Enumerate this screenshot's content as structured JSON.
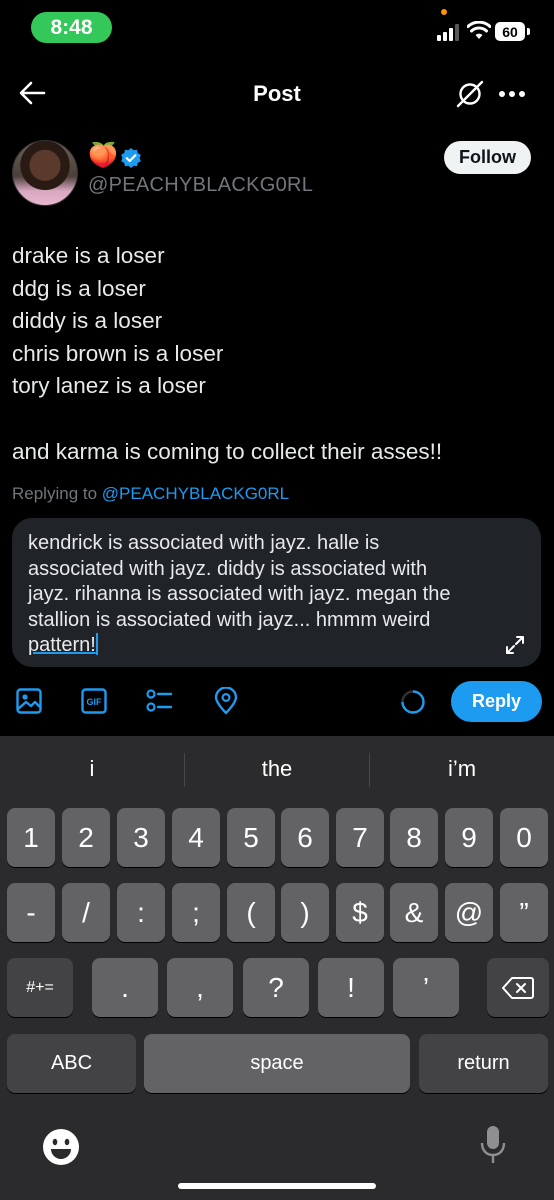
{
  "status_bar": {
    "time": "8:48",
    "battery": "60"
  },
  "header": {
    "title": "Post"
  },
  "post": {
    "author_emoji": "🍑",
    "handle": "@PEACHYBLACKG0RL",
    "follow_label": "Follow",
    "lines": [
      "drake is a loser",
      "ddg is a loser",
      "diddy is a loser",
      "chris brown is a loser",
      "tory lanez is a loser",
      "",
      "and karma is coming to collect their asses!!"
    ]
  },
  "reply": {
    "replying_prefix": "Replying to ",
    "replying_handle": "@PEACHYBLACKG0RL",
    "lines": [
      "kendrick is associated with jayz. halle is",
      "associated with jayz. diddy is associated with",
      "jayz. rihanna is associated with jayz. megan the",
      "stallion is associated with jayz... hmmm weird"
    ],
    "last_word": "pattern!",
    "reply_label": "Reply"
  },
  "toolbar_icons": [
    "image-icon",
    "gif-icon",
    "poll-icon",
    "location-icon"
  ],
  "keyboard": {
    "suggestions": [
      "i",
      "the",
      "i’m"
    ],
    "row1": [
      "1",
      "2",
      "3",
      "4",
      "5",
      "6",
      "7",
      "8",
      "9",
      "0"
    ],
    "row2": [
      "-",
      "/",
      ":",
      ";",
      "(",
      ")",
      "$",
      "&",
      "@",
      "”"
    ],
    "row3_left": "#+=",
    "row3": [
      ".",
      ",",
      "?",
      "!",
      "’"
    ],
    "abc": "ABC",
    "space": "space",
    "return": "return"
  },
  "colors": {
    "accent": "#1d9bf0",
    "status_green": "#34c759",
    "background": "#000000"
  }
}
